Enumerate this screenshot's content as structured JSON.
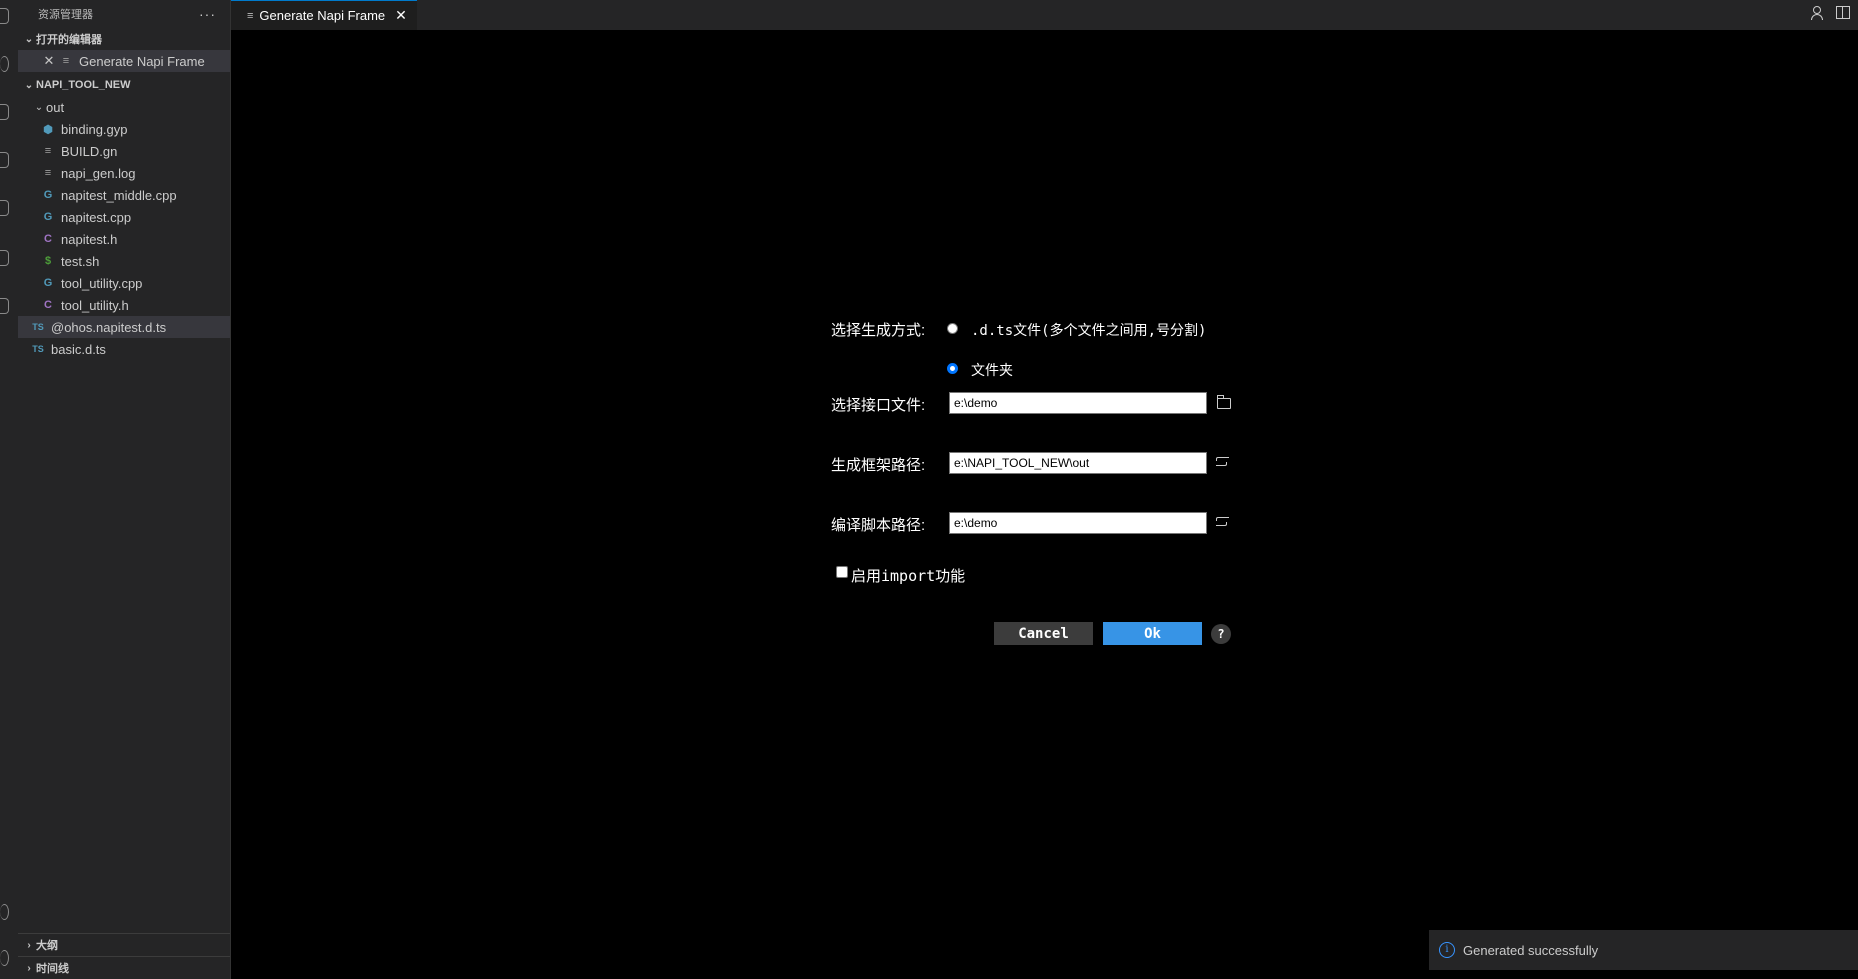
{
  "sidebar": {
    "title": "资源管理器",
    "more": "···",
    "open_editors": {
      "label": "打开的编辑器",
      "items": [
        {
          "name": "Generate Napi Frame",
          "close": "✕"
        }
      ]
    },
    "project": {
      "label": "NAPI_TOOL_NEW",
      "folder": "out",
      "files": [
        {
          "name": "binding.gyp",
          "icon": "⬢"
        },
        {
          "name": "BUILD.gn",
          "icon": "≡"
        },
        {
          "name": "napi_gen.log",
          "icon": "≡"
        },
        {
          "name": "napitest_middle.cpp",
          "icon": "G"
        },
        {
          "name": "napitest.cpp",
          "icon": "G"
        },
        {
          "name": "napitest.h",
          "icon": "C"
        },
        {
          "name": "test.sh",
          "icon": "$"
        },
        {
          "name": "tool_utility.cpp",
          "icon": "G"
        },
        {
          "name": "tool_utility.h",
          "icon": "C"
        }
      ],
      "root_files": [
        {
          "name": "@ohos.napitest.d.ts",
          "icon": "TS"
        },
        {
          "name": "basic.d.ts",
          "icon": "TS"
        }
      ]
    },
    "outline": "大纲",
    "timeline": "时间线"
  },
  "tab": {
    "title": "Generate Napi Frame",
    "close": "✕",
    "icon": "≡"
  },
  "form": {
    "mode_label": "选择生成方式:",
    "option_file": ".d.ts文件(多个文件之间用,号分割)",
    "option_folder": "文件夹",
    "selected_option": "文件夹",
    "interface_label": "选择接口文件:",
    "interface_value": "e:\\demo",
    "frame_label": "生成框架路径:",
    "frame_value": "e:\\NAPI_TOOL_NEW\\out",
    "script_label": "编译脚本路径:",
    "script_value": "e:\\demo",
    "import_label": "启用import功能",
    "import_checked": false,
    "cancel": "Cancel",
    "ok": "Ok",
    "help": "?"
  },
  "notification": {
    "icon": "i",
    "text": "Generated successfully"
  },
  "colors": {
    "accent": "#3794e6",
    "radio_checked": "#0075ff",
    "sidebar_bg": "#252526",
    "editor_bg": "#000000"
  }
}
